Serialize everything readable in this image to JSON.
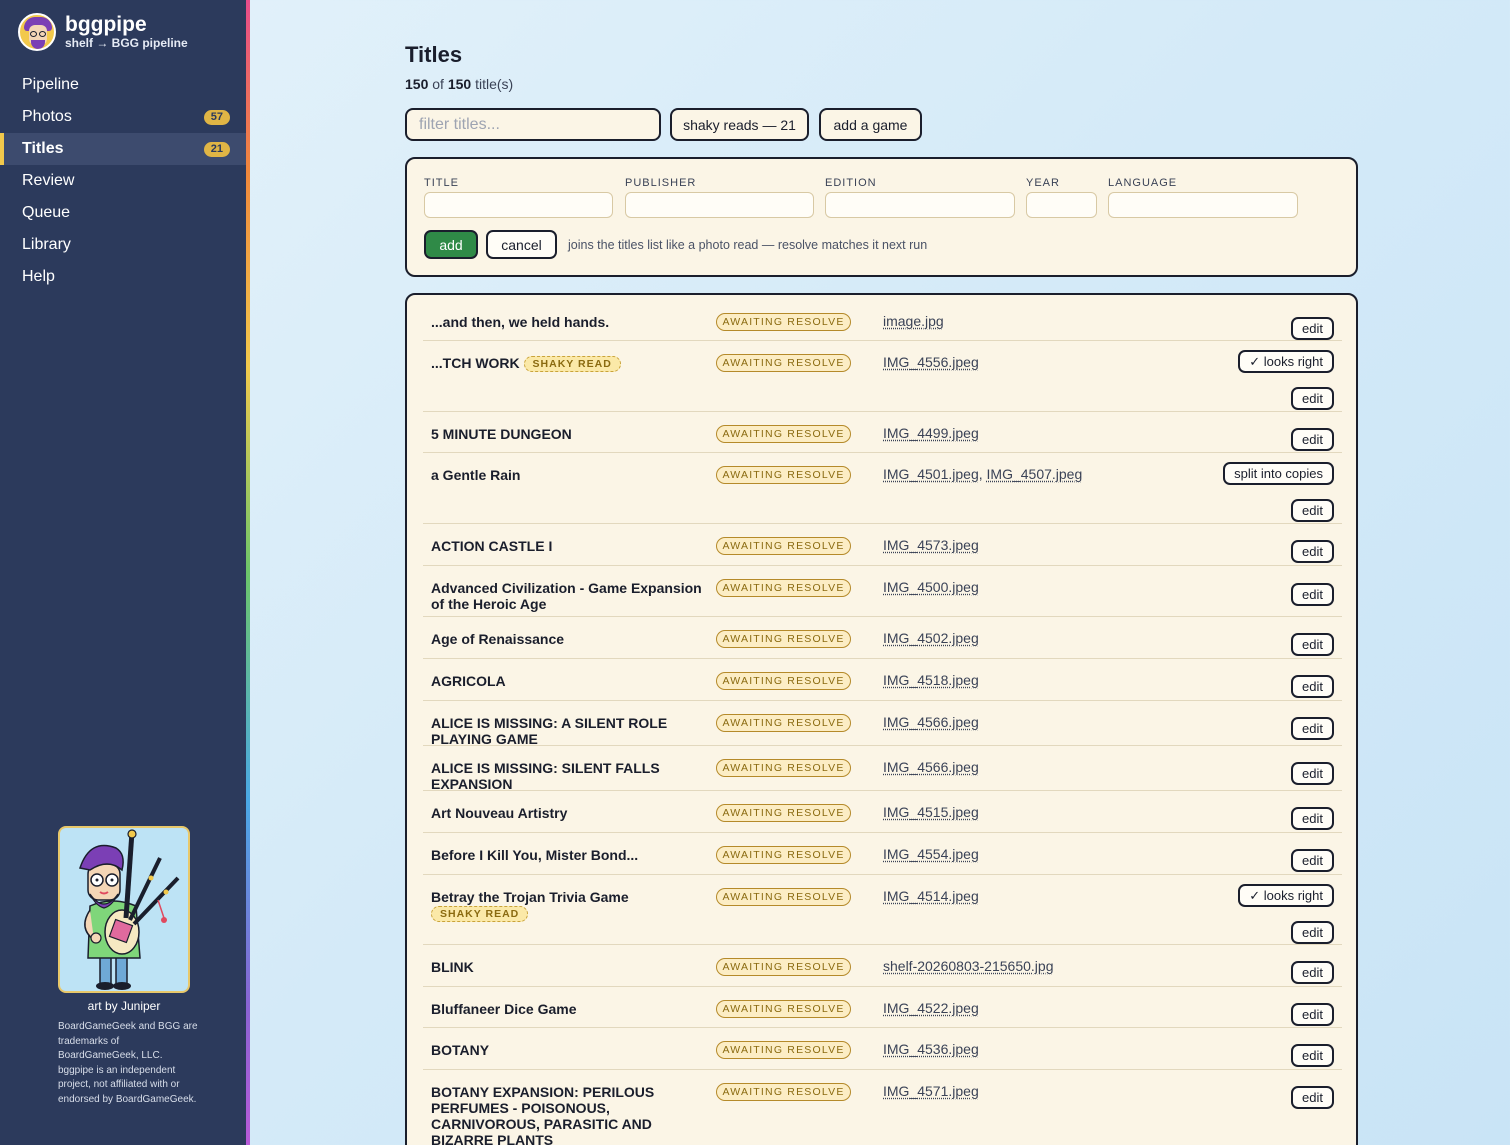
{
  "app": {
    "name": "bggpipe",
    "subtitle": "shelf → BGG pipeline"
  },
  "sidebar": {
    "items": [
      {
        "label": "Pipeline",
        "badge": null,
        "active": false
      },
      {
        "label": "Photos",
        "badge": "57",
        "active": false
      },
      {
        "label": "Titles",
        "badge": "21",
        "active": true
      },
      {
        "label": "Review",
        "badge": null,
        "active": false
      },
      {
        "label": "Queue",
        "badge": null,
        "active": false
      },
      {
        "label": "Library",
        "badge": null,
        "active": false
      },
      {
        "label": "Help",
        "badge": null,
        "active": false
      }
    ],
    "art_credit": "art by Juniper",
    "trademark": "BoardGameGeek and BGG are trademarks of BoardGameGeek, LLC. bggpipe is an independent project, not affiliated with or endorsed by BoardGameGeek."
  },
  "page": {
    "title": "Titles",
    "count_shown": "150",
    "count_of": "of",
    "count_total": "150",
    "count_suffix": "title(s)"
  },
  "toolbar": {
    "filter_placeholder": "filter titles...",
    "shaky_label": "shaky reads — 21",
    "add_game_label": "add a game"
  },
  "add_form": {
    "fields": {
      "title": "TITLE",
      "publisher": "PUBLISHER",
      "edition": "EDITION",
      "year": "YEAR",
      "language": "LANGUAGE"
    },
    "add_label": "add",
    "cancel_label": "cancel",
    "hint": "joins the titles list like a photo read — resolve matches it next run"
  },
  "labels": {
    "shaky": "SHAKY READ",
    "status": "AWAITING RESOLVE",
    "edit": "edit",
    "looks_right": "✓ looks right",
    "split": "split into copies"
  },
  "rows": [
    {
      "title": "...and then, we held hands.",
      "files": [
        "image.jpg"
      ]
    },
    {
      "title": "...TCH WORK",
      "shaky": true,
      "files": [
        "IMG_4556.jpeg"
      ],
      "looks_right": true
    },
    {
      "title": "5 MINUTE DUNGEON",
      "files": [
        "IMG_4499.jpeg"
      ]
    },
    {
      "title": "a Gentle Rain",
      "files": [
        "IMG_4501.jpeg",
        "IMG_4507.jpeg"
      ],
      "split": true
    },
    {
      "title": "ACTION CASTLE I",
      "files": [
        "IMG_4573.jpeg"
      ]
    },
    {
      "title": "Advanced Civilization - Game Expansion of the Heroic Age",
      "files": [
        "IMG_4500.jpeg"
      ]
    },
    {
      "title": "Age of Renaissance",
      "files": [
        "IMG_4502.jpeg"
      ]
    },
    {
      "title": "AGRICOLA",
      "files": [
        "IMG_4518.jpeg"
      ]
    },
    {
      "title": "ALICE IS MISSING: A SILENT ROLE PLAYING GAME",
      "files": [
        "IMG_4566.jpeg"
      ]
    },
    {
      "title": "ALICE IS MISSING: SILENT FALLS EXPANSION",
      "files": [
        "IMG_4566.jpeg"
      ]
    },
    {
      "title": "Art Nouveau Artistry",
      "files": [
        "IMG_4515.jpeg"
      ]
    },
    {
      "title": "Before I Kill You, Mister Bond...",
      "files": [
        "IMG_4554.jpeg"
      ]
    },
    {
      "title": "Betray the Trojan Trivia Game",
      "shaky": true,
      "files": [
        "IMG_4514.jpeg"
      ],
      "looks_right": true
    },
    {
      "title": "BLINK",
      "files": [
        "shelf-20260803-215650.jpg"
      ]
    },
    {
      "title": "Bluffaneer Dice Game",
      "files": [
        "IMG_4522.jpeg"
      ]
    },
    {
      "title": "BOTANY",
      "files": [
        "IMG_4536.jpeg"
      ]
    },
    {
      "title": "BOTANY EXPANSION: PERILOUS PERFUMES - POISONOUS, CARNIVOROUS, PARASITIC AND BIZARRE PLANTS",
      "files": [
        "IMG_4571.jpeg"
      ]
    }
  ]
}
